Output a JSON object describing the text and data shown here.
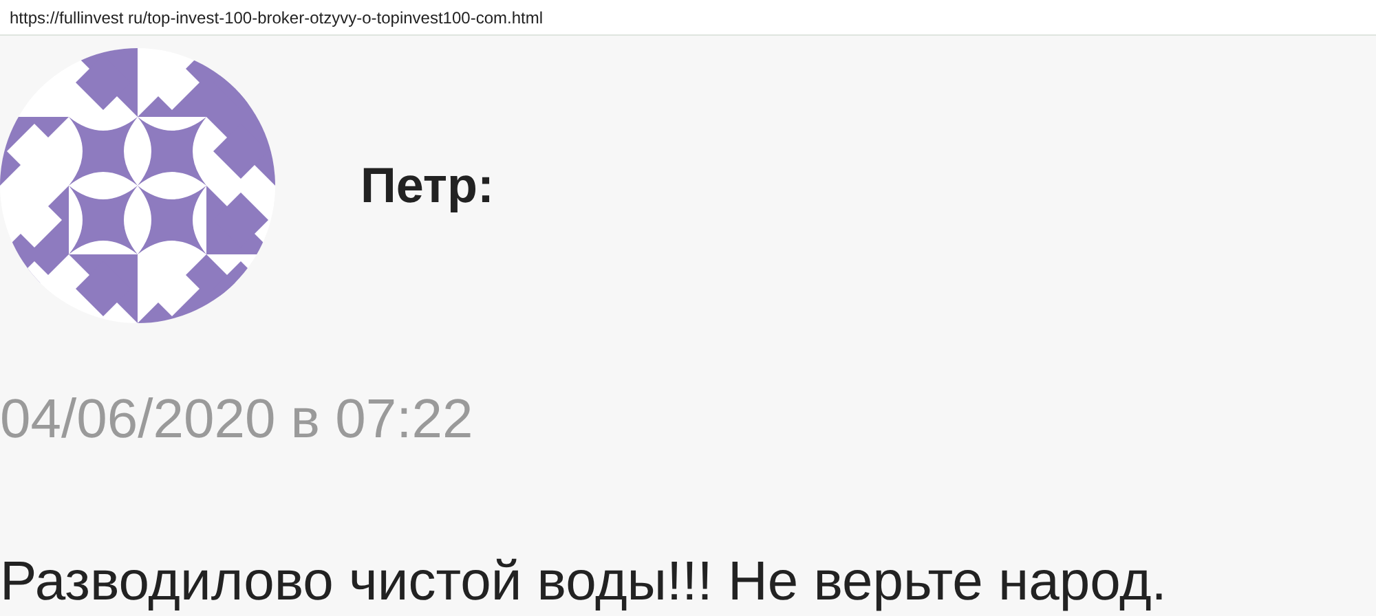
{
  "address_bar": {
    "url": "https://fullinvest ru/top-invest-100-broker-otzyvy-o-topinvest100-com.html"
  },
  "comment": {
    "author": "Петр:",
    "date": "04/06/2020 в 07:22",
    "text": "Разводилово чистой воды!!! Не верьте народ."
  }
}
